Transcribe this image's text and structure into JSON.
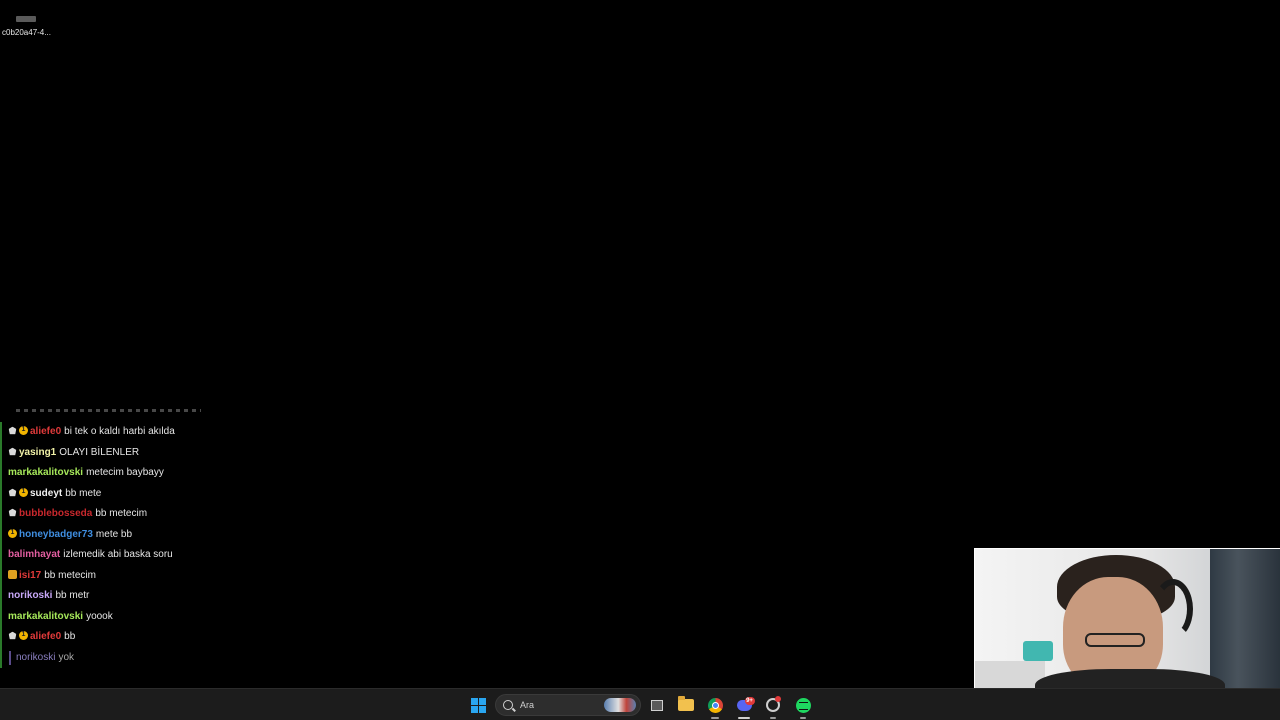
{
  "desktop": {
    "icon_label": "c0b20a47-4..."
  },
  "chat": {
    "messages": [
      {
        "badges": [
          "wolf",
          "coin"
        ],
        "user": "aliefe0",
        "user_color": "#e03a3a",
        "text": "bi tek o kaldı harbi akılda",
        "bar": "#2a7a2a"
      },
      {
        "badges": [
          "wolf"
        ],
        "user": "yasing1",
        "user_color": "#f2f2a8",
        "text": "OLAYI BİLENLER",
        "bar": "#2a7a2a"
      },
      {
        "badges": [],
        "user": "markakalitovski",
        "user_color": "#a6e85a",
        "text": "metecim baybayy",
        "bar": "#2a7a2a"
      },
      {
        "badges": [
          "wolf",
          "coin"
        ],
        "user": "sudeyt",
        "user_color": "#f0f0f0",
        "text": "bb mete",
        "bar": "#2a7a2a"
      },
      {
        "badges": [
          "wolf"
        ],
        "user": "bubblebosseda",
        "user_color": "#c9282d",
        "text": "bb metecim",
        "bar": "#2a7a2a"
      },
      {
        "badges": [
          "coin"
        ],
        "user": "honeybadger73",
        "user_color": "#3f8ee0",
        "text": "mete bb",
        "bar": "#2a7a2a"
      },
      {
        "badges": [],
        "user": "balimhayat",
        "user_color": "#e25ea0",
        "text": "izlemedik abi baska soru",
        "bar": "#2a7a2a"
      },
      {
        "badges": [
          "crown"
        ],
        "user": "isi17",
        "user_color": "#e03a3a",
        "text": "bb metecim",
        "bar": "#2a7a2a"
      },
      {
        "badges": [],
        "user": "norikoski",
        "user_color": "#c8a8f8",
        "text": "bb metr",
        "bar": "#2a7a2a"
      },
      {
        "badges": [],
        "user": "markakalitovski",
        "user_color": "#a6e85a",
        "text": "yoook",
        "bar": "#2a7a2a"
      },
      {
        "badges": [
          "wolf",
          "coin"
        ],
        "user": "aliefe0",
        "user_color": "#e03a3a",
        "text": "bb",
        "bar": "#2a7a2a"
      }
    ],
    "reply": {
      "user": "norikoski",
      "text": "yok"
    }
  },
  "taskbar": {
    "search_placeholder": "Ara",
    "discord_badge": "9+",
    "accent": "#2aa6f0",
    "icons": [
      "start-icon",
      "search-icon",
      "task-view-icon",
      "folder-icon",
      "chrome-icon",
      "discord-icon",
      "steam-icon",
      "spotify-icon"
    ]
  }
}
